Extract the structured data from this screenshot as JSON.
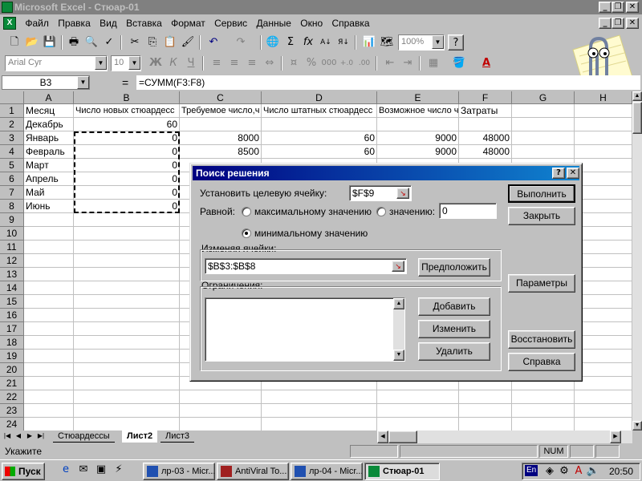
{
  "window": {
    "title": "Microsoft Excel - Стюар-01"
  },
  "menu": [
    "Файл",
    "Правка",
    "Вид",
    "Вставка",
    "Формат",
    "Сервис",
    "Данные",
    "Окно",
    "Справка"
  ],
  "toolbar": {
    "zoom": "100%"
  },
  "format_toolbar": {
    "font": "Arial Cyr",
    "size": "10",
    "bold": "Ж",
    "italic": "К",
    "underline": "Ч",
    "percent": "%",
    "thousands": "000"
  },
  "formula_bar": {
    "name_box": "B3",
    "eq": "=",
    "formula": "=СУММ(F3:F8)"
  },
  "columns": [
    "A",
    "B",
    "C",
    "D",
    "E",
    "F",
    "G",
    "H"
  ],
  "rows": [
    "1",
    "2",
    "3",
    "4",
    "5",
    "6",
    "7",
    "8",
    "9",
    "10",
    "11",
    "12",
    "13",
    "14",
    "15",
    "16",
    "17",
    "18",
    "19",
    "20",
    "21",
    "22",
    "23",
    "24"
  ],
  "cells": {
    "A1": "Месяц",
    "B1": "Число новых стюардесс",
    "C1": "Требуемое число,ч",
    "D1": "Число штатных стюардесс",
    "E1": "Возможное число ч",
    "F1": "Затраты",
    "A2": "Декабрь",
    "B2": "60",
    "A3": "Январь",
    "B3": "0",
    "C3": "8000",
    "D3": "60",
    "E3": "9000",
    "F3": "48000",
    "A4": "Февраль",
    "B4": "0",
    "C4": "8500",
    "D4": "60",
    "E4": "9000",
    "F4": "48000",
    "A5": "Март",
    "B5": "0",
    "A6": "Апрель",
    "B6": "0",
    "A7": "Май",
    "B7": "0",
    "A8": "Июнь",
    "B8": "0"
  },
  "sheet_tabs": [
    "Стюардессы",
    "Лист2",
    "Лист3"
  ],
  "active_sheet": "Лист2",
  "status": {
    "text": "Укажите",
    "num": "NUM"
  },
  "dialog": {
    "title": "Поиск решения",
    "target_label": "Установить целевую ячейку:",
    "target_value": "$F$9",
    "equal_label": "Равной:",
    "opt_max": "максимальному значению",
    "opt_value": "значению:",
    "value_input": "0",
    "opt_min": "минимальному значению",
    "changing_label": "Изменяя ячейки:",
    "changing_value": "$B$3:$B$8",
    "guess_btn": "Предположить",
    "constraints_label": "Ограничения:",
    "add_btn": "Добавить",
    "change_btn": "Изменить",
    "delete_btn": "Удалить",
    "solve_btn": "Выполнить",
    "close_btn": "Закрыть",
    "options_btn": "Параметры",
    "reset_btn": "Восстановить",
    "help_btn": "Справка",
    "help_q": "?",
    "close_x": "✕"
  },
  "taskbar": {
    "start": "Пуск",
    "tasks": [
      "лр-03 - Micr...",
      "AntiViral To...",
      "лр-04 - Micr...",
      "Стюар-01"
    ],
    "lang": "En",
    "time": "20:50"
  },
  "colors": {
    "title_active": "#000080",
    "title_gradient": "#1084d0",
    "face": "#c0c0c0",
    "excel_green": "#0a8a3a"
  }
}
